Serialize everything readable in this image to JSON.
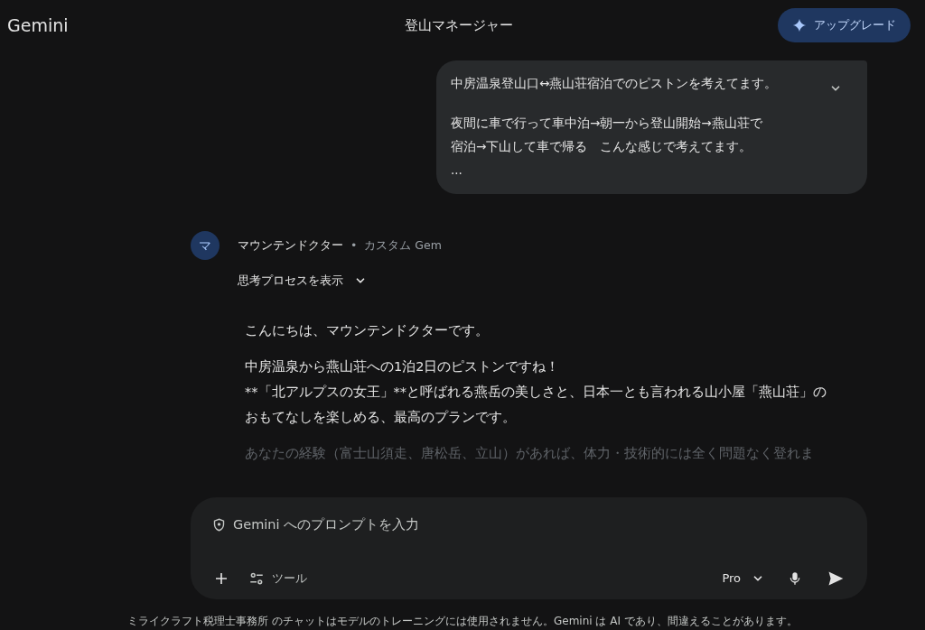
{
  "header": {
    "brand": "Gemini",
    "title": "登山マネージャー",
    "upgrade_button": "アップグレード"
  },
  "user_message": {
    "expanded": false,
    "paragraphs": [
      [
        "中房温泉登山口↔燕山荘宿泊でのピストンを考えてます。"
      ],
      [
        "夜間に車で行って車中泊→朝一から登山開始→燕山荘で",
        "宿泊→下山して車で帰る　こんな感じで考えてます。",
        "..."
      ]
    ]
  },
  "response": {
    "avatar": "マ",
    "author": "マウンテンドクター",
    "separator": "•",
    "badge": "カスタム Gem",
    "thinking_toggle": "思考プロセスを表示",
    "paragraphs": [
      {
        "faded": false,
        "lines": [
          "こんにちは、マウンテンドクターです。"
        ]
      },
      {
        "faded": false,
        "lines": [
          "中房温泉から燕山荘への1泊2日のピストンですね！",
          "**「北アルプスの女王」**と呼ばれる燕岳の美しさと、日本一とも言われる山小屋「燕山荘」の",
          "おもてなしを楽しめる、最高のプランです。"
        ]
      },
      {
        "faded": true,
        "lines": [
          "あなたの経験（富士山須走、唐松岳、立山）があれば、体力・技術的には全く問題なく登れま"
        ]
      }
    ]
  },
  "composer": {
    "placeholder": "Gemini へのプロンプトを入力",
    "tools": "ツール",
    "model": "Pro"
  },
  "footer": "ミライクラフト税理士事務所 のチャットはモデルのトレーニングには使用されません。Gemini は AI であり、間違えることがあります。"
}
